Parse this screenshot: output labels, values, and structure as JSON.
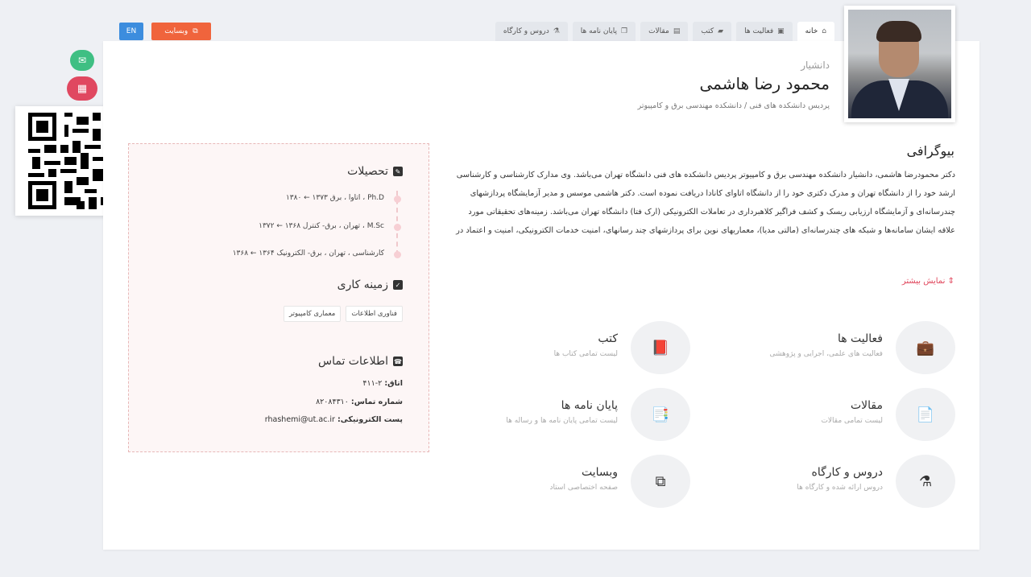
{
  "tabs": [
    {
      "label": "خانه",
      "icon": "home-icon",
      "active": true
    },
    {
      "label": "فعالیت ها",
      "icon": "briefcase-icon"
    },
    {
      "label": "کتب",
      "icon": "book-icon"
    },
    {
      "label": "مقالات",
      "icon": "file-icon"
    },
    {
      "label": "پایان نامه ها",
      "icon": "files-icon"
    },
    {
      "label": "دروس و کارگاه",
      "icon": "flask-icon"
    }
  ],
  "header_buttons": {
    "en": "EN",
    "website": "وبسایت"
  },
  "profile": {
    "rank": "دانشیار",
    "name": "محمود رضا هاشمی",
    "affiliation": "پردیس دانشکده های فنی / دانشکده مهندسی برق و کامپیوتر"
  },
  "info": {
    "education_title": "تحصیلات",
    "education": [
      "Ph.D ، اتاوا ، برق ۱۳۷۳ ← ۱۳۸۰",
      "M.Sc ، تهران ، برق- کنترل ۱۳۶۸ ← ۱۳۷۲",
      "کارشناسی ، تهران ، برق- الکترونیک ۱۳۶۴ ← ۱۳۶۸"
    ],
    "field_title": "زمینه کاری",
    "fields": [
      "فناوری اطلاعات",
      "معماری کامپیوتر"
    ],
    "contact_title": "اطلاعات تماس",
    "room_label": "اتاق:",
    "room": "۲-۴۱۱",
    "phone_label": "شماره تماس:",
    "phone": "۸۲۰۸۴۳۱۰",
    "email_label": "پست الکترونیکی:",
    "email": "rhashemi@ut.ac.ir"
  },
  "bio": {
    "title": "بیوگرافی",
    "text": "دکتر محمودرضا هاشمی، دانشیار دانشکده مهندسی برق و کامپیوتر پردیس دانشکده های فنی دانشگاه تهران می‌باشد. وی مدارک کارشناسی و کارشناسی ارشد خود را از دانشگاه تهران و مدرک دکتری خود را از دانشگاه اتاوای کانادا دریافت نموده است. دکتر هاشمی موسس و مدیر آزمایشگاه پردازشهای چندرسانه‌ای و آزمایشگاه ارزیابی ریسک و کشف فراگیر کلاهبرداری در تعاملات الکترونیکی (ارک فتا) دانشگاه تهران می‌باشد. زمینه‌های تحقیقاتی مورد علاقه ایشان سامانه‌ها و شبکه های چندرسانه‌ای (مالتی مدیا)، معماریهای نوین برای پردازشهای چند رسانهای، امنیت خدمات الکترونیکی، امنیت و اعتماد در",
    "more": "نمایش بیشتر"
  },
  "tiles": [
    {
      "title": "فعالیت ها",
      "subtitle": "فعالیت های علمی، اجرایی و پژوهشی",
      "icon": "briefcase-icon"
    },
    {
      "title": "کتب",
      "subtitle": "لیست تمامی کتاب ها",
      "icon": "book-icon"
    },
    {
      "title": "مقالات",
      "subtitle": "لیست تمامی مقالات",
      "icon": "file-icon"
    },
    {
      "title": "پایان نامه ها",
      "subtitle": "لیست تمامی پایان نامه ها و رساله ها",
      "icon": "files-icon"
    },
    {
      "title": "دروس و کارگاه",
      "subtitle": "دروس ارائه شده و کارگاه ها",
      "icon": "flask-icon"
    },
    {
      "title": "وبسایت",
      "subtitle": "صفحه اختصاصی استاد",
      "icon": "external-link-icon"
    }
  ]
}
